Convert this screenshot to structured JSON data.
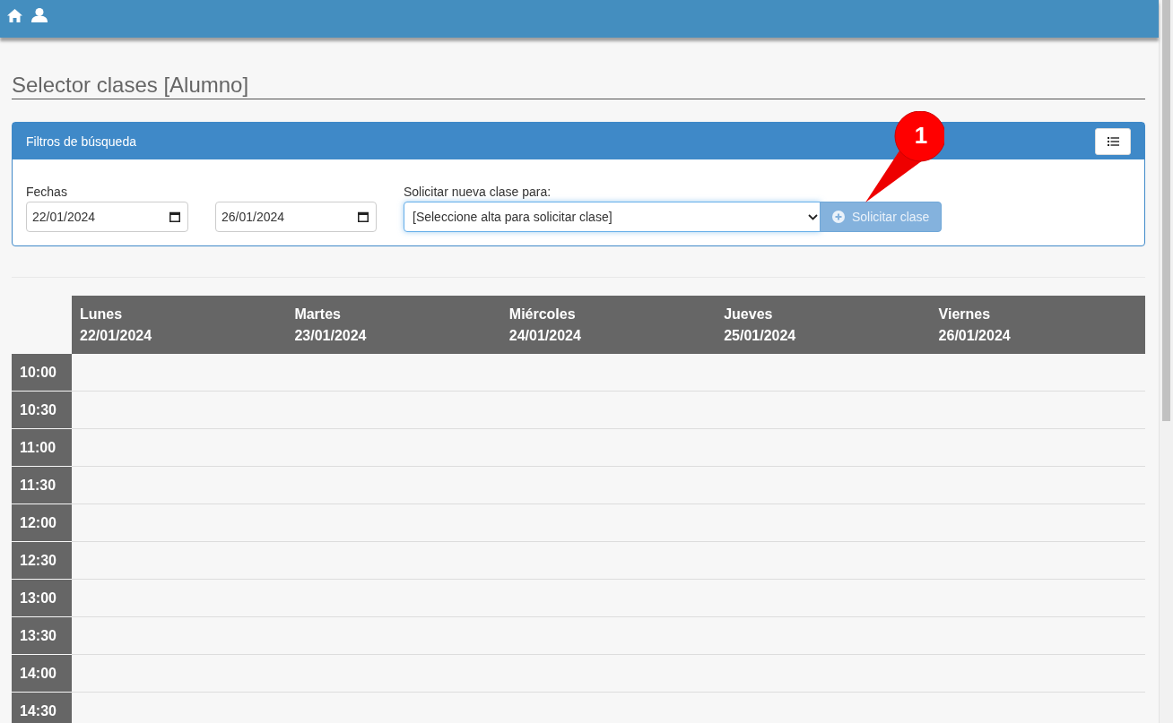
{
  "page_title": "Selector clases [Alumno]",
  "filters": {
    "title": "Filtros de búsqueda",
    "dates_label": "Fechas",
    "date_from": "22/01/2024",
    "date_to": "26/01/2024",
    "request_label": "Solicitar nueva clase para:",
    "request_select": "[Seleccione alta para solicitar clase]",
    "request_button": {
      "label": "Solicitar clase",
      "disabled": true
    }
  },
  "calendar": {
    "days": [
      {
        "name": "Lunes",
        "date": "22/01/2024"
      },
      {
        "name": "Martes",
        "date": "23/01/2024"
      },
      {
        "name": "Miércoles",
        "date": "24/01/2024"
      },
      {
        "name": "Jueves",
        "date": "25/01/2024"
      },
      {
        "name": "Viernes",
        "date": "26/01/2024"
      }
    ],
    "times": [
      "10:00",
      "10:30",
      "11:00",
      "11:30",
      "12:00",
      "12:30",
      "13:00",
      "13:30",
      "14:00",
      "14:30"
    ]
  },
  "callout": {
    "label": "1"
  }
}
